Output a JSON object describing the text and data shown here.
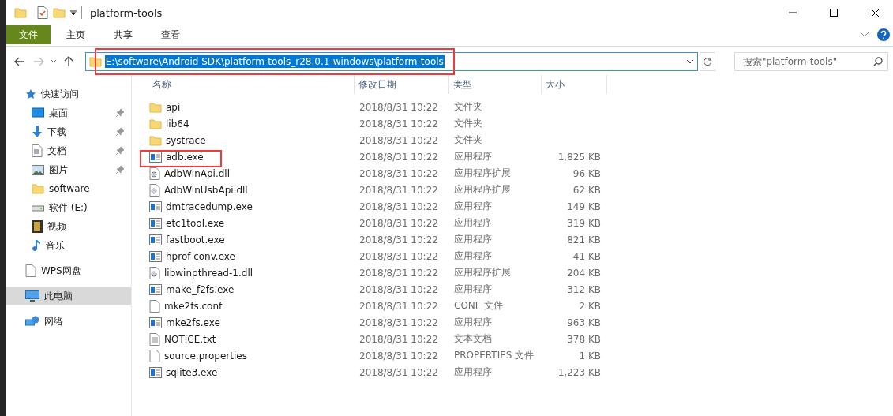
{
  "window": {
    "title": "platform-tools"
  },
  "ribbon_tabs": [
    {
      "label": "文件",
      "kind": "file"
    },
    {
      "label": "主页",
      "kind": "tab"
    },
    {
      "label": "共享",
      "kind": "tab"
    },
    {
      "label": "查看",
      "kind": "tab"
    }
  ],
  "address": {
    "path": "E:\\software\\Android SDK\\platform-tools_r28.0.1-windows\\platform-tools",
    "highlighted": true
  },
  "search": {
    "placeholder": "搜索\"platform-tools\""
  },
  "sidebar": {
    "items": [
      {
        "label": "快速访问",
        "kind": "star",
        "selected": false,
        "children": [
          {
            "label": "桌面",
            "kind": "desktop",
            "pinned": true,
            "selected": false
          },
          {
            "label": "下载",
            "kind": "download",
            "pinned": true,
            "selected": false
          },
          {
            "label": "文档",
            "kind": "document",
            "pinned": true,
            "selected": false
          },
          {
            "label": "图片",
            "kind": "image",
            "pinned": true,
            "selected": false
          },
          {
            "label": "software",
            "kind": "folder",
            "pinned": false,
            "selected": false
          },
          {
            "label": "软件 (E:)",
            "kind": "drive",
            "pinned": false,
            "selected": false
          },
          {
            "label": "视频",
            "kind": "film",
            "pinned": false,
            "selected": false
          },
          {
            "label": "音乐",
            "kind": "music",
            "pinned": false,
            "selected": false
          }
        ]
      },
      {
        "label": "WPS网盘",
        "kind": "file",
        "selected": false
      },
      {
        "label": "此电脑",
        "kind": "computer",
        "selected": true
      },
      {
        "label": "网络",
        "kind": "network",
        "selected": false
      }
    ]
  },
  "table": {
    "columns": [
      "名称",
      "修改日期",
      "类型",
      "大小"
    ],
    "rows": [
      {
        "name": "api",
        "kind": "folder",
        "date": "2018/8/31 10:22",
        "type": "文件夹",
        "highlighted": false
      },
      {
        "name": "lib64",
        "kind": "folder",
        "date": "2018/8/31 10:22",
        "type": "文件夹",
        "highlighted": false
      },
      {
        "name": "systrace",
        "kind": "folder",
        "date": "2018/8/31 10:22",
        "type": "文件夹",
        "highlighted": false
      },
      {
        "name": "adb.exe",
        "kind": "exe",
        "date": "2018/8/31 10:22",
        "type": "应用程序",
        "size": "1,825 KB",
        "highlighted": true
      },
      {
        "name": "AdbWinApi.dll",
        "kind": "dll",
        "date": "2018/8/31 10:22",
        "type": "应用程序扩展",
        "size": "96 KB",
        "highlighted": false
      },
      {
        "name": "AdbWinUsbApi.dll",
        "kind": "dll",
        "date": "2018/8/31 10:22",
        "type": "应用程序扩展",
        "size": "62 KB",
        "highlighted": false
      },
      {
        "name": "dmtracedump.exe",
        "kind": "exe",
        "date": "2018/8/31 10:22",
        "type": "应用程序",
        "size": "149 KB",
        "highlighted": false
      },
      {
        "name": "etc1tool.exe",
        "kind": "exe",
        "date": "2018/8/31 10:22",
        "type": "应用程序",
        "size": "319 KB",
        "highlighted": false
      },
      {
        "name": "fastboot.exe",
        "kind": "exe",
        "date": "2018/8/31 10:22",
        "type": "应用程序",
        "size": "821 KB",
        "highlighted": false
      },
      {
        "name": "hprof-conv.exe",
        "kind": "exe",
        "date": "2018/8/31 10:22",
        "type": "应用程序",
        "size": "41 KB",
        "highlighted": false
      },
      {
        "name": "libwinpthread-1.dll",
        "kind": "dll",
        "date": "2018/8/31 10:22",
        "type": "应用程序扩展",
        "size": "204 KB",
        "highlighted": false
      },
      {
        "name": "make_f2fs.exe",
        "kind": "exe",
        "date": "2018/8/31 10:22",
        "type": "应用程序",
        "size": "312 KB",
        "highlighted": false
      },
      {
        "name": "mke2fs.conf",
        "kind": "file",
        "date": "2018/8/31 10:22",
        "type": "CONF 文件",
        "size": "2 KB",
        "highlighted": false
      },
      {
        "name": "mke2fs.exe",
        "kind": "exe",
        "date": "2018/8/31 10:22",
        "type": "应用程序",
        "size": "963 KB",
        "highlighted": false
      },
      {
        "name": "NOTICE.txt",
        "kind": "text",
        "date": "2018/8/31 10:22",
        "type": "文本文档",
        "size": "378 KB",
        "highlighted": false
      },
      {
        "name": "source.properties",
        "kind": "file",
        "date": "2018/8/31 10:22",
        "type": "PROPERTIES 文件",
        "size": "1 KB",
        "highlighted": false
      },
      {
        "name": "sqlite3.exe",
        "kind": "exe",
        "date": "2018/8/31 10:22",
        "type": "应用程序",
        "size": "1,223 KB",
        "highlighted": false
      }
    ]
  }
}
